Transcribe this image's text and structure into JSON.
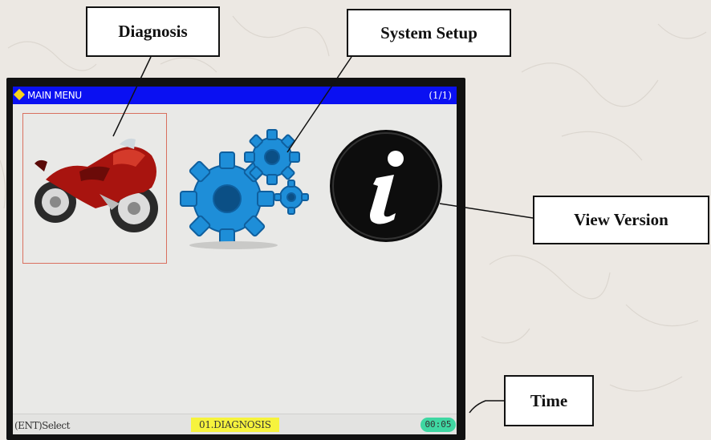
{
  "screen": {
    "title": "MAIN MENU",
    "page_indicator": "(1/1)",
    "menu": [
      {
        "id": "diagnosis",
        "icon": "motorcycle-icon",
        "selected": true
      },
      {
        "id": "system-setup",
        "icon": "gears-icon",
        "selected": false
      },
      {
        "id": "view-version",
        "icon": "info-icon",
        "selected": false
      }
    ],
    "status": {
      "hint": "(ENT)Select",
      "selection": "01.DIAGNOSIS",
      "time": "00:05"
    }
  },
  "callouts": {
    "diagnosis": "Diagnosis",
    "system_setup": "System Setup",
    "view_version": "View Version",
    "time": "Time"
  },
  "colors": {
    "title_bar": "#0a10f2",
    "title_diamond": "#f7d31a",
    "selection_highlight": "#f6f33d",
    "time_badge": "#3fd7a2",
    "selected_outline": "#d9705f",
    "gear_blue": "#1e8ed8",
    "info_black": "#0d0d0d"
  }
}
